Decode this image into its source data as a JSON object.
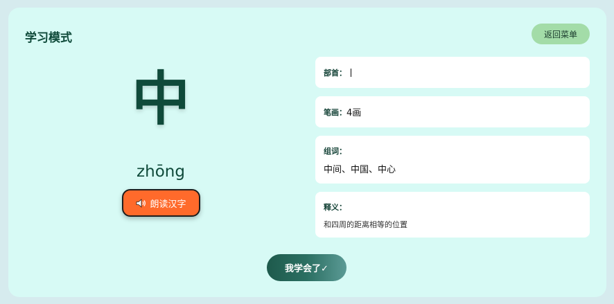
{
  "header": {
    "title": "学习模式",
    "back_label": "返回菜单"
  },
  "character": {
    "glyph": "中",
    "pinyin": "zhōng",
    "read_label": "朗读汉字"
  },
  "details": {
    "radical_label": "部首：",
    "radical_value": "丨",
    "strokes_label": "笔画：",
    "strokes_value": "4画",
    "words_label": "组词：",
    "words_value": "中间、中国、中心",
    "meaning_label": "释义：",
    "meaning_value": "和四周的距离相等的位置"
  },
  "footer": {
    "learned_label": "我学会了✓"
  },
  "colors": {
    "accent_dark": "#0f4a3a",
    "read_button": "#ff6a2b",
    "back_button": "#a3dca8",
    "card_bg": "#d7faf5"
  }
}
